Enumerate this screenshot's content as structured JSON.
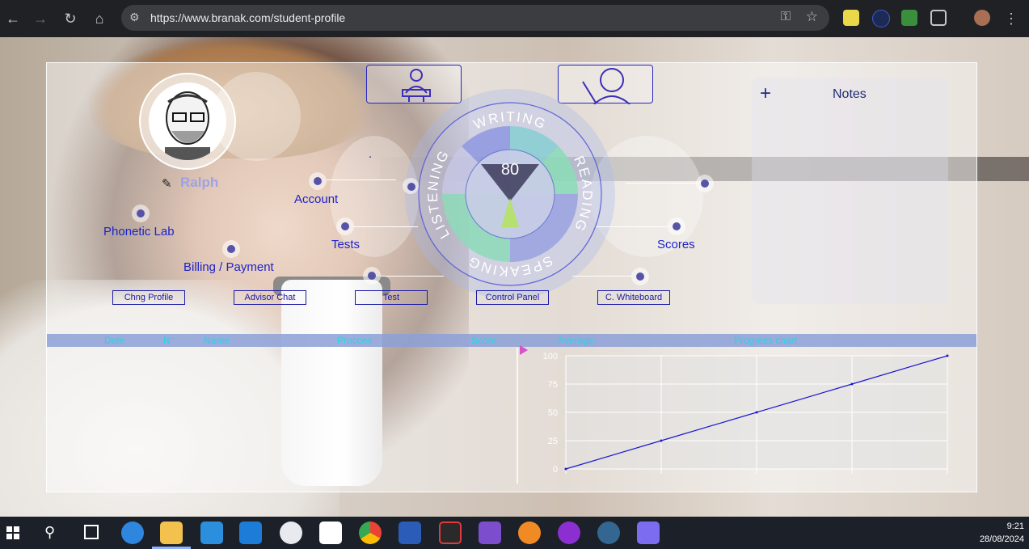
{
  "browser": {
    "url": "https://www.branak.com/student-profile"
  },
  "profile": {
    "username": "Ralph"
  },
  "notes": {
    "title": "Notes",
    "add_label": "+"
  },
  "skill_wheel": {
    "score": "80",
    "writing": "WRITING",
    "reading": "READING",
    "speaking": "SPEAKING",
    "listening": "LISTENING",
    "colors": {
      "blue": "#8f98e0",
      "teal": "#86cfd2",
      "green": "#8ddab8",
      "lime": "#b6e070",
      "dark": "#3c3a5a"
    }
  },
  "nav": {
    "dot": ".",
    "account": "Account",
    "phonetic_lab": "Phonetic Lab",
    "tests": "Tests",
    "scores": "Scores",
    "billing": "Billing / Payment"
  },
  "small_buttons": {
    "chng_profile": "Chng Profile",
    "advisor_chat": "Advisor Chat",
    "test": "Test",
    "control_panel": "Control Panel",
    "whiteboard": "C. Whiteboard"
  },
  "table_headers": [
    "Date",
    "N°",
    "Name",
    "Procces",
    "Score",
    "Average",
    "Progress chart"
  ],
  "chart_data": {
    "type": "line",
    "title": "",
    "xlabel": "",
    "ylabel": "",
    "ylim": [
      0,
      100
    ],
    "yticks": [
      "100",
      "75",
      "50",
      "25",
      "0"
    ],
    "x": [
      0,
      1,
      2,
      3,
      4
    ],
    "series": [
      {
        "values": [
          0,
          25,
          50,
          75,
          100
        ],
        "color": "#1a18d0"
      }
    ],
    "grid": true
  },
  "taskbar": {
    "time": "9:21",
    "date": "28/08/2024"
  }
}
